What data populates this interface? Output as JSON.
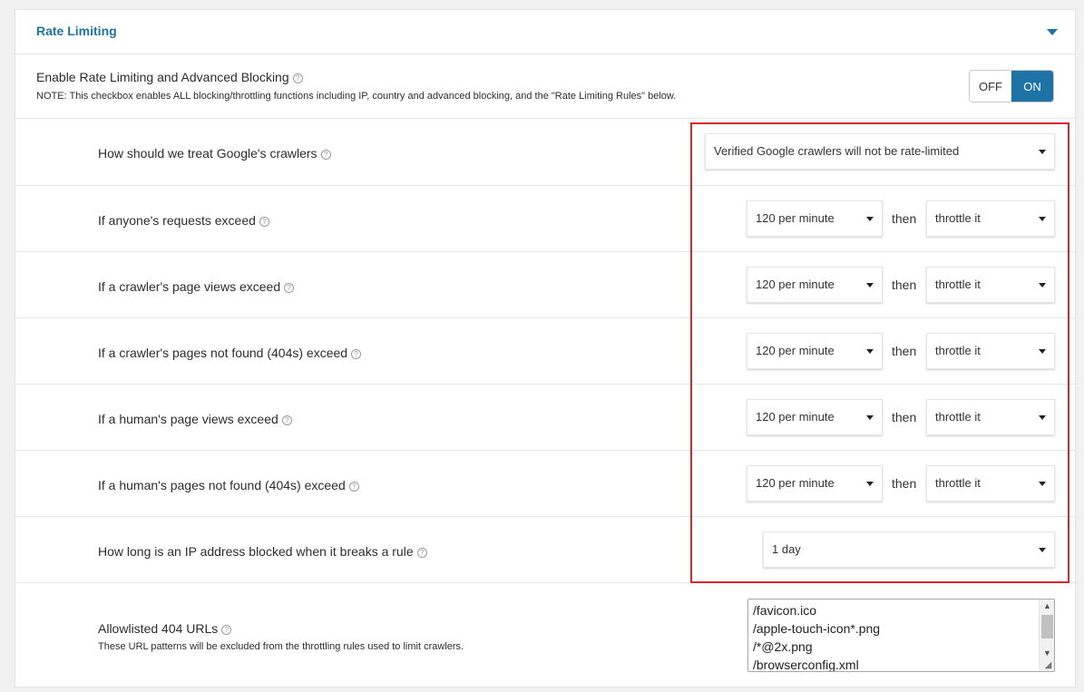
{
  "panel": {
    "title": "Rate Limiting",
    "collapse_icon": "chevron-down-icon",
    "accent_color": "#1d73a6"
  },
  "master": {
    "label": "Enable Rate Limiting and Advanced Blocking",
    "help_icon": "?",
    "note": "NOTE: This checkbox enables ALL blocking/throttling functions including IP, country and advanced blocking, and the \"Rate Limiting Rules\" below.",
    "toggle": {
      "off_label": "OFF",
      "on_label": "ON",
      "state": "ON"
    }
  },
  "google": {
    "label": "How should we treat Google's crawlers",
    "value": "Verified Google crawlers will not be rate-limited"
  },
  "rules": [
    {
      "label": "If anyone's requests exceed",
      "rate": "120 per minute",
      "then": "then",
      "action": "throttle it"
    },
    {
      "label": "If a crawler's page views exceed",
      "rate": "120 per minute",
      "then": "then",
      "action": "throttle it"
    },
    {
      "label": "If a crawler's pages not found (404s) exceed",
      "rate": "120 per minute",
      "then": "then",
      "action": "throttle it"
    },
    {
      "label": "If a human's page views exceed",
      "rate": "120 per minute",
      "then": "then",
      "action": "throttle it"
    },
    {
      "label": "If a human's pages not found (404s) exceed",
      "rate": "120 per minute",
      "then": "then",
      "action": "throttle it"
    }
  ],
  "block_duration": {
    "label": "How long is an IP address blocked when it breaks a rule",
    "value": "1 day"
  },
  "allowlist": {
    "label": "Allowlisted 404 URLs",
    "note": "These URL patterns will be excluded from the throttling rules used to limit crawlers.",
    "lines": [
      "/favicon.ico",
      "/apple-touch-icon*.png",
      "/*@2x.png",
      "/browserconfig.xml"
    ]
  },
  "highlight_color": "#d9262b"
}
